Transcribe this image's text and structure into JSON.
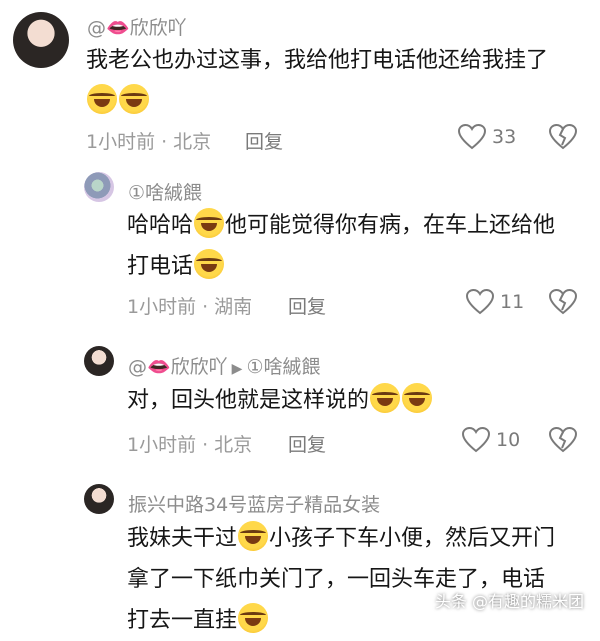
{
  "comments": [
    {
      "username": "@👄欣欣吖",
      "line1": "我老公也办过这事，我给他打电话他还给我挂了",
      "time": "1小时前",
      "location": "北京",
      "reply_label": "回复",
      "likes": "33"
    },
    {
      "username": "①啥絾餵",
      "line1": "哈哈哈",
      "line1b": "他可能觉得你有病，在车上还给他",
      "line2": "打电话",
      "time": "1小时前",
      "location": "湖南",
      "reply_label": "回复",
      "likes": "11"
    },
    {
      "username": "@👄欣欣吖",
      "reply_to": "①啥絾餵",
      "line1": "对，回头他就是这样说的",
      "time": "1小时前",
      "location": "北京",
      "reply_label": "回复",
      "likes": "10"
    },
    {
      "username": "振兴中路34号蓝房子精品女装",
      "line1": "我妹夫干过",
      "line1b": "小孩子下车小便，然后又开门",
      "line2": "拿了一下纸巾关门了，一回头车走了，电话",
      "line3": "打去一直挂"
    }
  ],
  "watermark": "头条 @有趣的糯米团",
  "icons": {
    "emoji": "laughing-crying-emoji",
    "like": "heart-icon",
    "dislike": "broken-heart-icon"
  }
}
